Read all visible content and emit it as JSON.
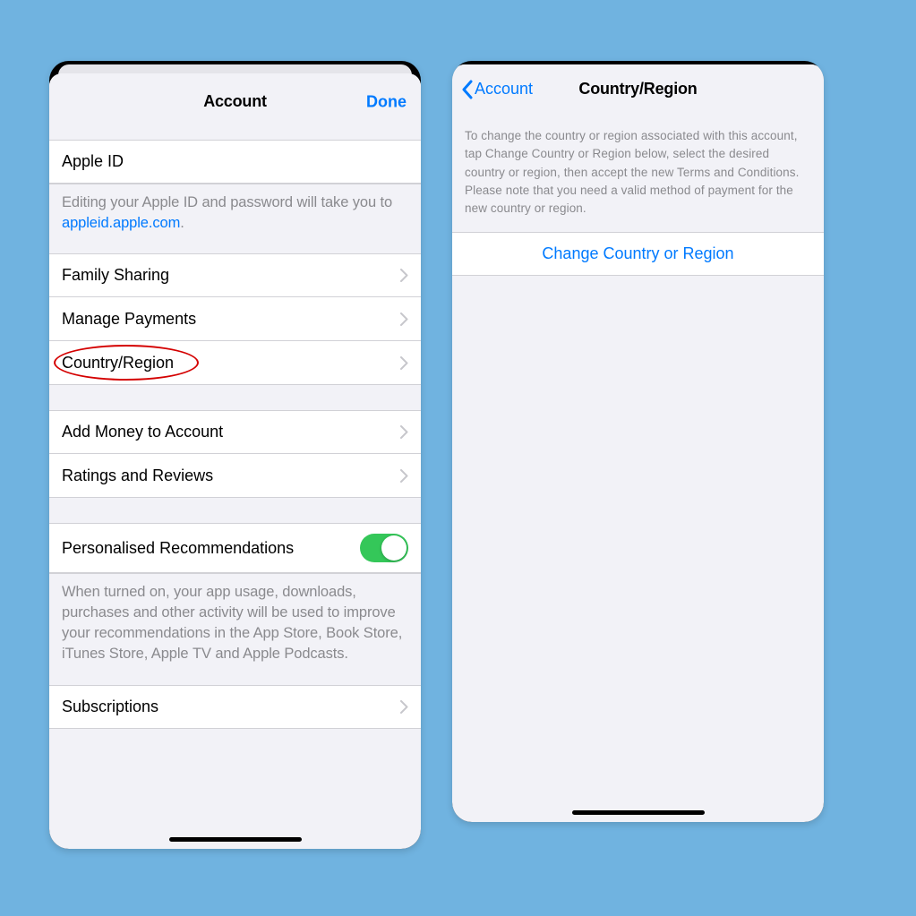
{
  "left": {
    "title": "Account",
    "done": "Done",
    "apple_id_row": "Apple ID",
    "apple_id_desc_pre": "Editing your Apple ID and password will take you to ",
    "apple_id_link": "appleid.apple.com",
    "apple_id_desc_post": ".",
    "rows1": [
      "Family Sharing",
      "Manage Payments",
      "Country/Region"
    ],
    "rows2": [
      "Add Money to Account",
      "Ratings and Reviews"
    ],
    "toggle_label": "Personalised Recommendations",
    "toggle_desc": "When turned on, your app usage, downloads, purchases and other activity will be used to improve your recommendations in the App Store, Book Store, iTunes Store, Apple TV and Apple Podcasts.",
    "rows3": [
      "Subscriptions"
    ]
  },
  "right": {
    "back_label": "Account",
    "title": "Country/Region",
    "info": "To change the country or region associated with this account, tap Change Country or Region below, select the desired country or region, then accept the new Terms and Conditions. Please note that you need a valid method of payment for the new country or region.",
    "action": "Change Country or Region"
  }
}
